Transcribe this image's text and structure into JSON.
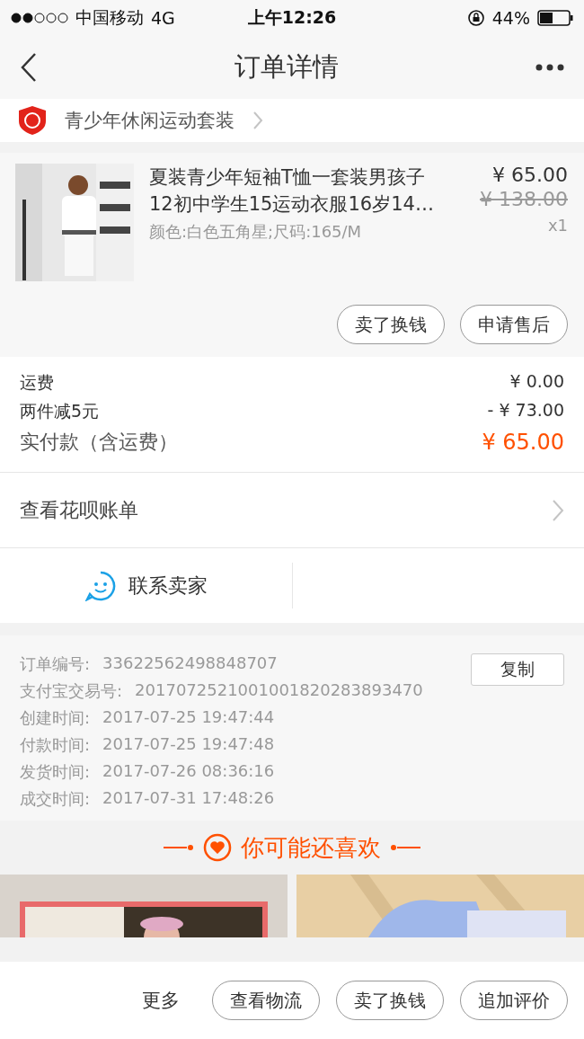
{
  "status_bar": {
    "carrier": "中国移动",
    "network": "4G",
    "time": "上午12:26",
    "battery": "44%"
  },
  "nav": {
    "title": "订单详情"
  },
  "shop": {
    "name": "青少年休闲运动套装"
  },
  "item": {
    "image": {
      "kind": "picture"
    },
    "title": "夏装青少年短袖T恤一套装男孩子12初中学生15运动衣服16岁14…",
    "spec": "颜色:白色五角星;尺码:165/M",
    "price": "¥ 65.00",
    "original_price": "¥ 138.00",
    "quantity": "x1",
    "actions": [
      "卖了换钱",
      "申请售后"
    ]
  },
  "fees": [
    {
      "label": "运费",
      "value": "¥ 0.00"
    },
    {
      "label": "两件减5元",
      "value": "- ¥ 73.00"
    }
  ],
  "total": {
    "label": "实付款（含运费）",
    "value": "¥ 65.00"
  },
  "huabei": {
    "label": "查看花呗账单"
  },
  "contact": {
    "label": "联系卖家"
  },
  "order_info": {
    "copy_button": "复制",
    "rows": [
      {
        "label": "订单编号:",
        "value": "33622562498848707"
      },
      {
        "label": "支付宝交易号:",
        "value": "2017072521001001820283893470"
      },
      {
        "label": "创建时间:",
        "value": "2017-07-25 19:47:44"
      },
      {
        "label": "付款时间:",
        "value": "2017-07-25 19:47:48"
      },
      {
        "label": "发货时间:",
        "value": "2017-07-26 08:36:16"
      },
      {
        "label": "成交时间:",
        "value": "2017-07-31 17:48:26"
      }
    ]
  },
  "recommend": {
    "title": "你可能还喜欢",
    "items": [
      {
        "kind": "picture"
      },
      {
        "kind": "picture"
      }
    ]
  },
  "bottom_bar": {
    "more": "更多",
    "buttons": [
      "查看物流",
      "卖了换钱",
      "追加评价"
    ]
  }
}
